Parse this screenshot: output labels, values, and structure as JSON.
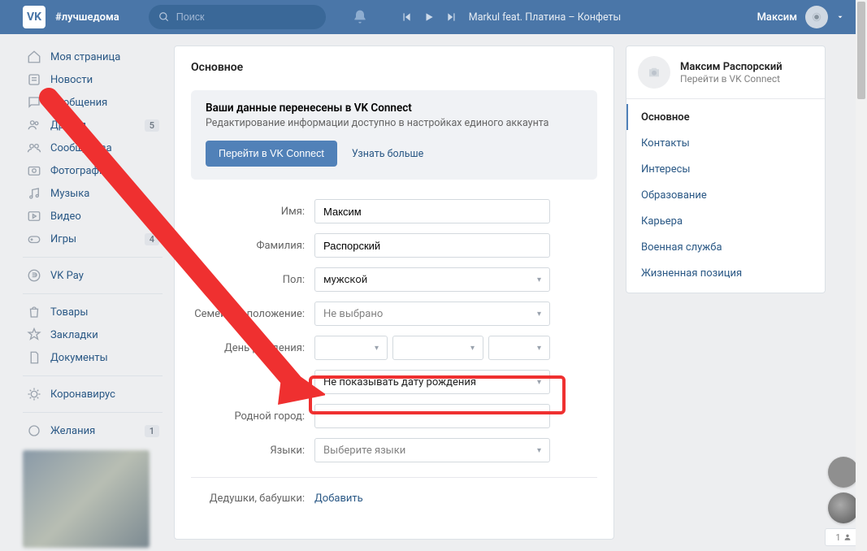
{
  "header": {
    "logo": "VK",
    "tagline": "#лучшедома",
    "search_placeholder": "Поиск",
    "track": "Markul feat. Платина – Конфеты",
    "user_name": "Максим"
  },
  "leftnav": [
    {
      "icon": "home",
      "label": "Моя страница"
    },
    {
      "icon": "news",
      "label": "Новости"
    },
    {
      "icon": "msg",
      "label": "Сообщения"
    },
    {
      "icon": "friends",
      "label": "Друзья",
      "badge": "5"
    },
    {
      "icon": "groups",
      "label": "Сообщества"
    },
    {
      "icon": "photo",
      "label": "Фотографии"
    },
    {
      "icon": "music",
      "label": "Музыка"
    },
    {
      "icon": "video",
      "label": "Видео"
    },
    {
      "icon": "games",
      "label": "Игры",
      "badge": "4"
    },
    {
      "sep": true
    },
    {
      "icon": "pay",
      "label": "VK Pay"
    },
    {
      "sep": true
    },
    {
      "icon": "market",
      "label": "Товары"
    },
    {
      "icon": "bookmarks",
      "label": "Закладки"
    },
    {
      "icon": "docs",
      "label": "Документы"
    },
    {
      "sep": true
    },
    {
      "icon": "covid",
      "label": "Коронавирус"
    },
    {
      "sep": true
    },
    {
      "icon": "wishes",
      "label": "Желания",
      "badge": "1"
    }
  ],
  "main": {
    "title": "Основное",
    "banner": {
      "title": "Ваши данные перенесены в VK Connect",
      "sub": "Редактирование информации доступно в настройках единого аккаунта",
      "primary": "Перейти в VK Connect",
      "secondary": "Узнать больше"
    },
    "form": {
      "name_label": "Имя:",
      "name_value": "Максим",
      "surname_label": "Фамилия:",
      "surname_value": "Распорский",
      "gender_label": "Пол:",
      "gender_value": "мужской",
      "marital_label": "Семейное положение:",
      "marital_value": "Не выбрано",
      "bday_label": "День рождения:",
      "bday_visibility": "Не показывать дату рождения",
      "hometown_label": "Родной город:",
      "hometown_value": "",
      "lang_label": "Языки:",
      "lang_value": "Выберите языки",
      "grandparents_label": "Дедушки, бабушки:",
      "grandparents_action": "Добавить"
    }
  },
  "right": {
    "profile_name": "Максим Распорский",
    "profile_sub": "Перейти в VK Connect",
    "tabs": [
      "Основное",
      "Контакты",
      "Интересы",
      "Образование",
      "Карьера",
      "Военная служба",
      "Жизненная позиция"
    ]
  },
  "float": {
    "count": "1"
  }
}
